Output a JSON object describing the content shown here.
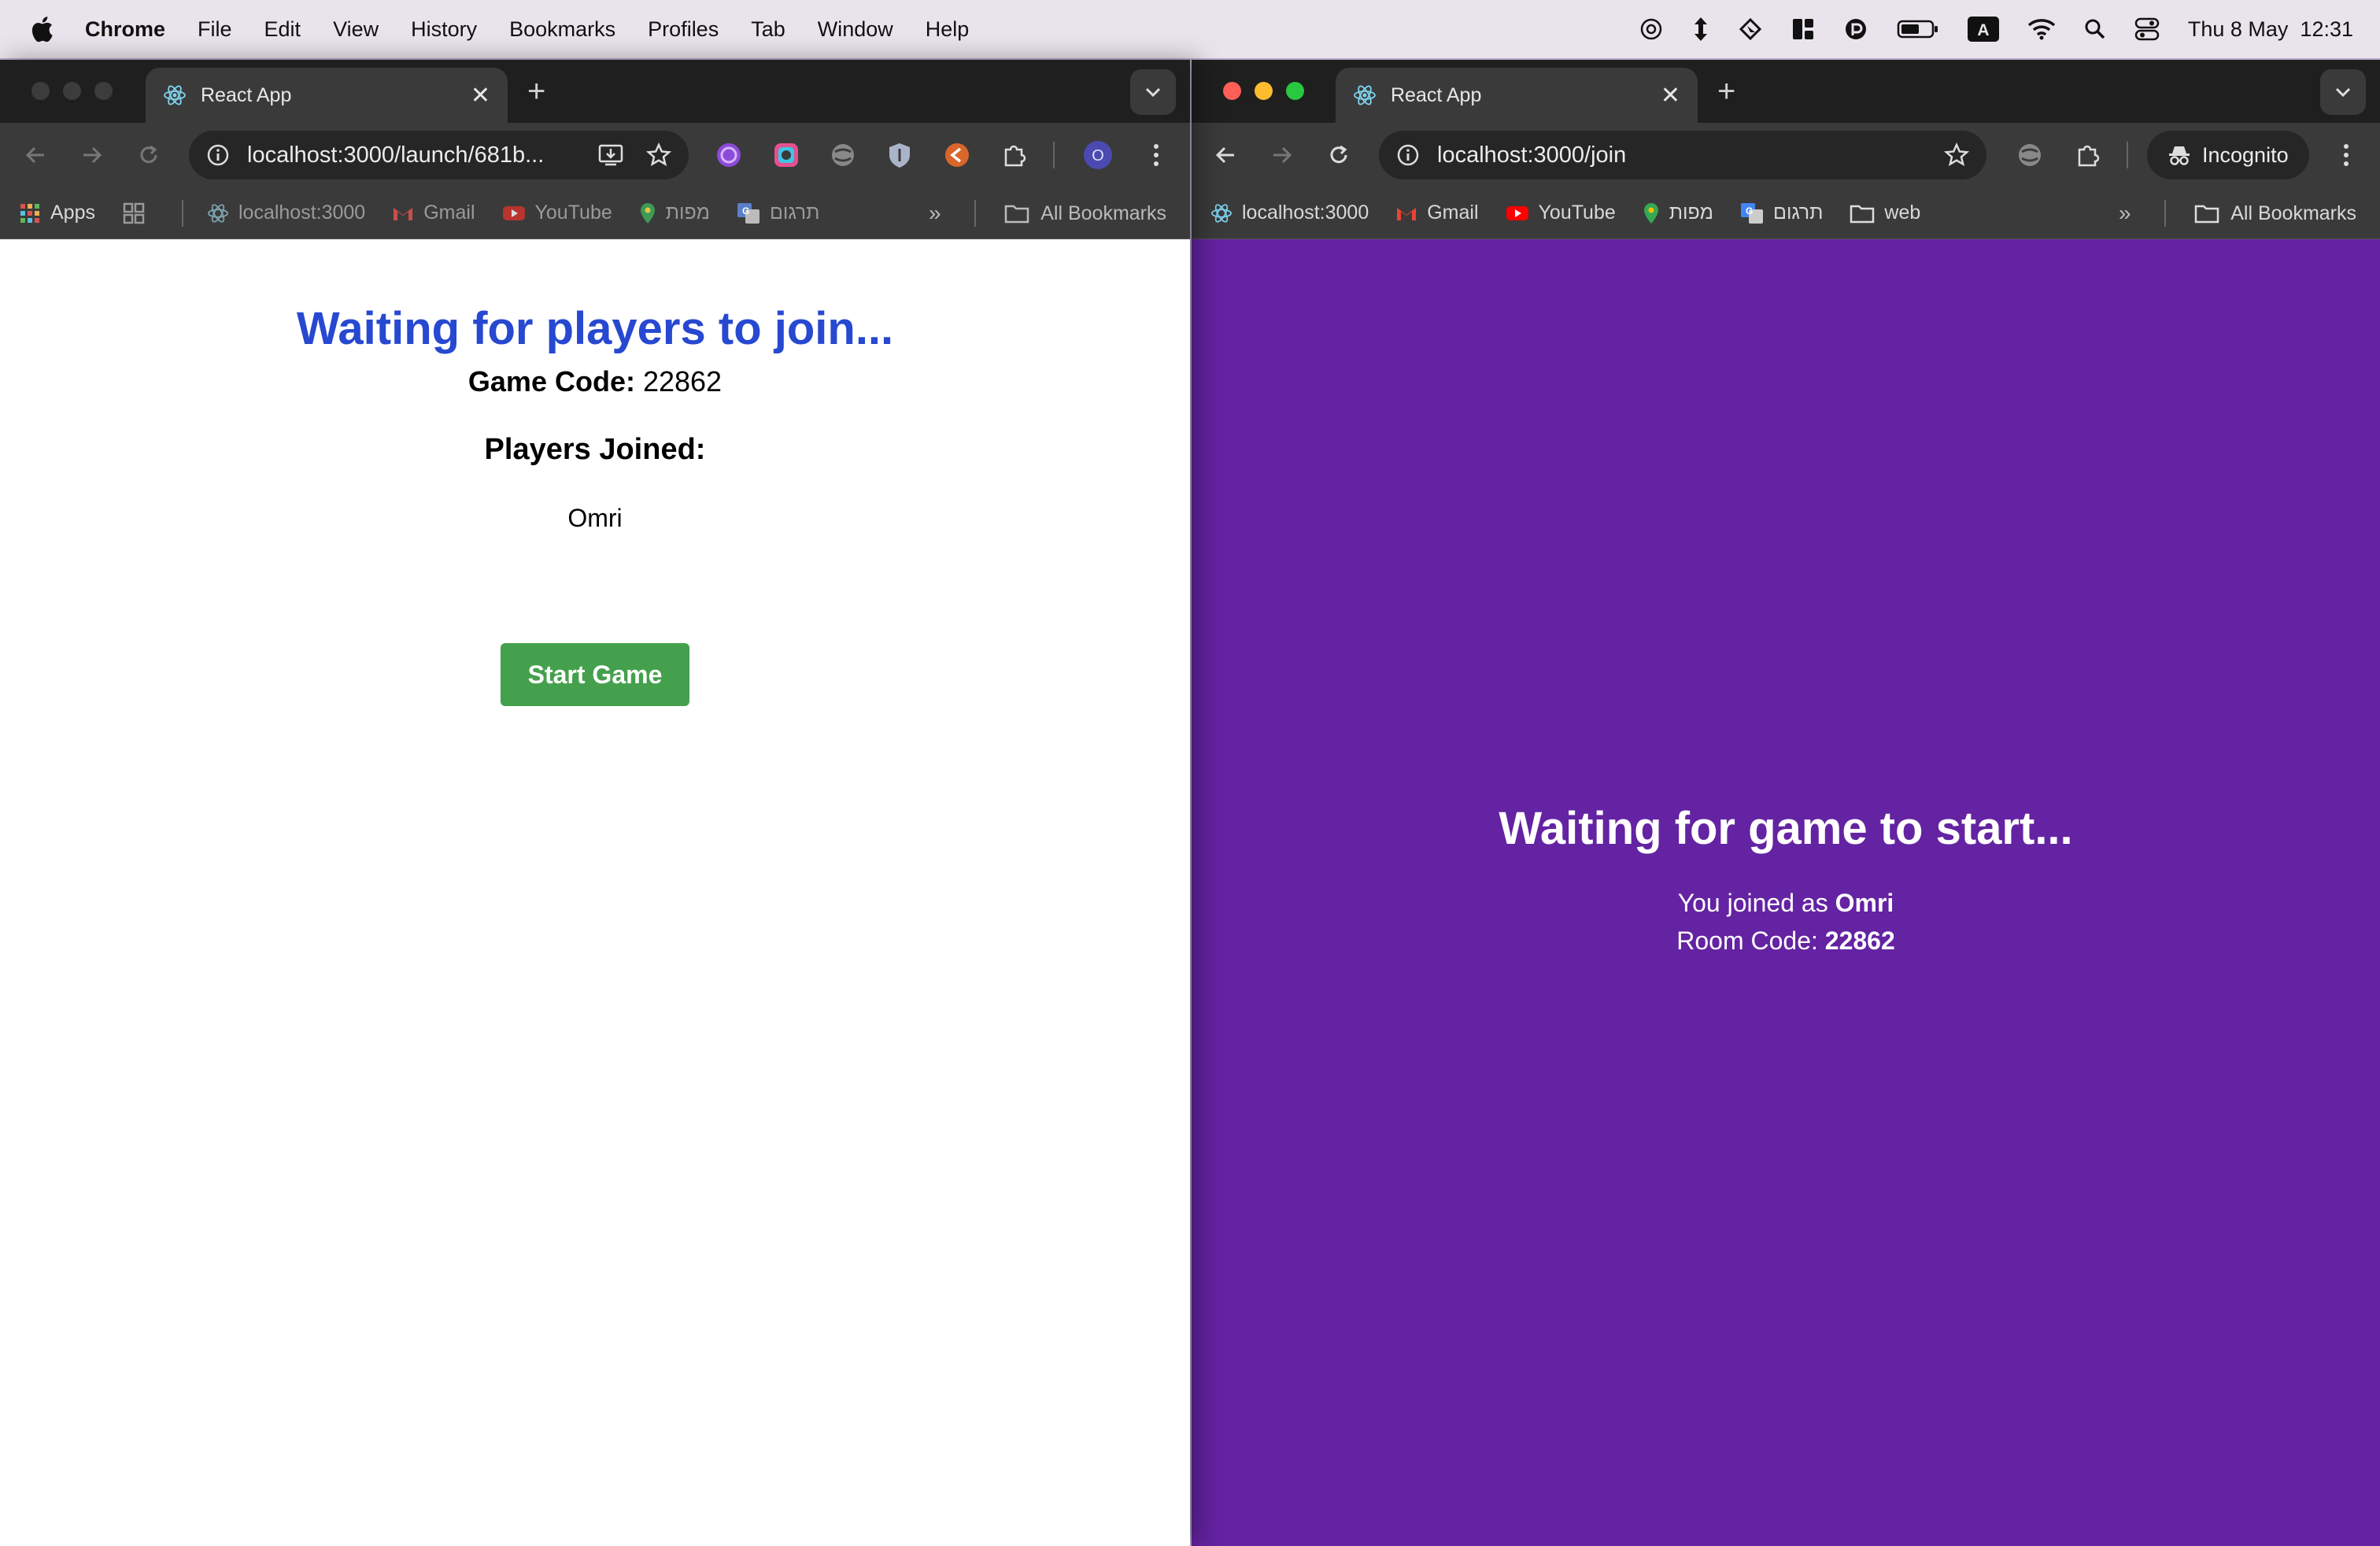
{
  "menubar": {
    "app": "Chrome",
    "items": [
      "File",
      "Edit",
      "View",
      "History",
      "Bookmarks",
      "Profiles",
      "Tab",
      "Window",
      "Help"
    ],
    "clock": "Thu 8 May  12:31",
    "status_icons": [
      "openai-icon",
      "arrow-updown-icon",
      "cursor-icon",
      "window-tile-icon",
      "pasta-icon",
      "battery-icon",
      "input-source-icon",
      "wifi-icon",
      "spotlight-icon",
      "control-center-icon"
    ],
    "input_source_label": "A"
  },
  "window_left": {
    "tab_title": "React App",
    "url": "localhost:3000/launch/681b...",
    "profile_initial": "O",
    "bookmarks": [
      "Apps",
      "localhost:3000",
      "Gmail",
      "YouTube",
      "מפות",
      "תרגום"
    ],
    "all_bookmarks": "All Bookmarks",
    "page": {
      "heading": "Waiting for players to join...",
      "game_code_label": "Game Code:",
      "game_code": "22862",
      "players_heading": "Players Joined:",
      "players": [
        "Omri"
      ],
      "start_button": "Start Game"
    },
    "colors": {
      "heading": "#2748d0",
      "button": "#45a04d",
      "background": "#ffffff"
    }
  },
  "window_right": {
    "tab_title": "React App",
    "url": "localhost:3000/join",
    "incognito_label": "Incognito",
    "bookmarks": [
      "localhost:3000",
      "Gmail",
      "YouTube",
      "מפות",
      "תרגום",
      "web"
    ],
    "all_bookmarks": "All Bookmarks",
    "page": {
      "heading": "Waiting for game to start...",
      "joined_prefix": "You joined as ",
      "player_name": "Omri",
      "room_code_prefix": "Room Code: ",
      "room_code": "22862"
    },
    "colors": {
      "background": "#6423a2"
    }
  }
}
